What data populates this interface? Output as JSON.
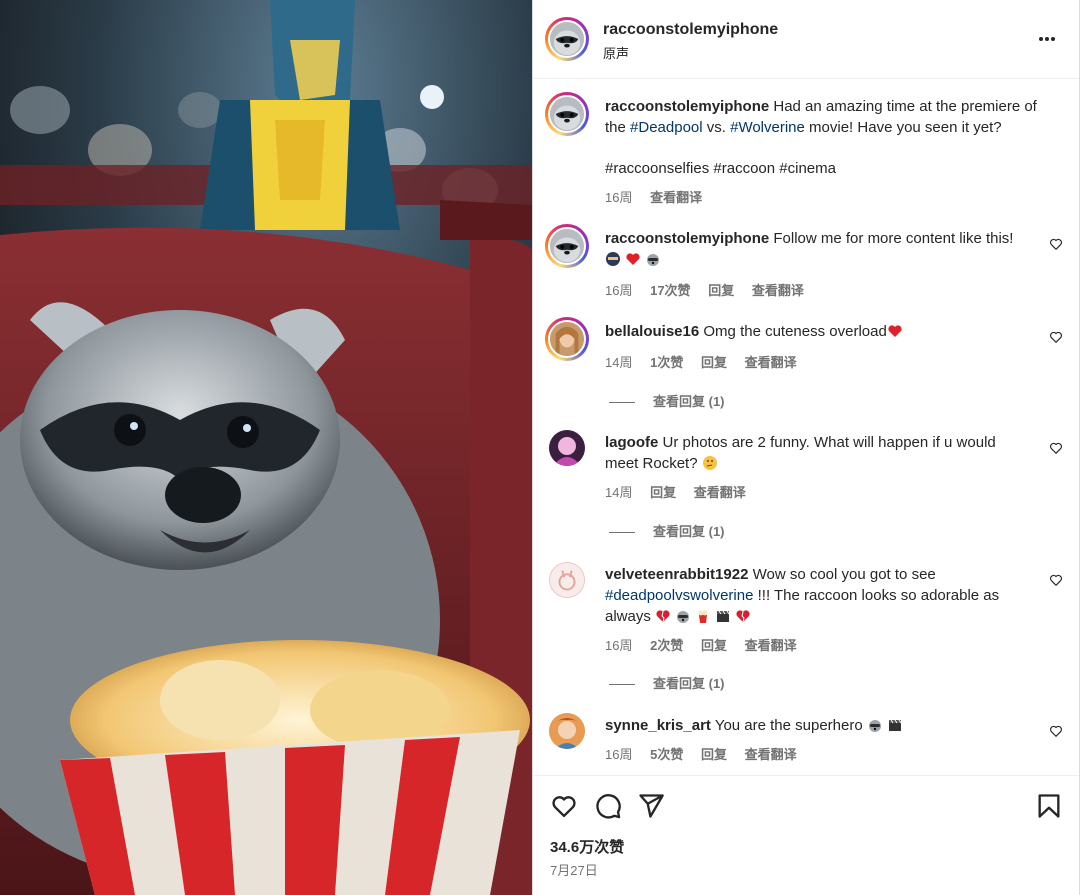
{
  "post": {
    "username": "raccoonstolemyiphone",
    "audio": "原声",
    "caption_text": "Had an amazing time at the premiere of the",
    "caption_tag1": "#Deadpool",
    "caption_mid": "vs.",
    "caption_tag2": "#Wolverine",
    "caption_end": "movie! Have you seen it yet?",
    "caption_hashtags": "#raccoonselfies #raccoon #cinema",
    "caption_time": "16周",
    "caption_translate": "查看翻译"
  },
  "comments": [
    {
      "user": "raccoonstolemyiphone",
      "text": "Follow me for more content like this!",
      "time": "16周",
      "likes": "17次赞",
      "reply": "回复",
      "translate": "查看翻译"
    },
    {
      "user": "bellalouise16",
      "text": "Omg the cuteness overload",
      "time": "14周",
      "likes": "1次赞",
      "reply": "回复",
      "translate": "查看翻译",
      "view_replies": "查看回复 (1)"
    },
    {
      "user": "lagoofe",
      "text": "Ur photos are 2 funny. What will happen if u would meet Rocket?",
      "time": "14周",
      "reply": "回复",
      "translate": "查看翻译",
      "view_replies": "查看回复 (1)"
    },
    {
      "user": "velveteenrabbit1922",
      "text_a": "Wow so cool you got to see",
      "tag": "#deadpoolvswolverine",
      "text_b": "!!! The raccoon looks so adorable as always",
      "time": "16周",
      "likes": "2次赞",
      "reply": "回复",
      "translate": "查看翻译",
      "view_replies": "查看回复 (1)"
    },
    {
      "user": "synne_kris_art",
      "text": "You are the superhero",
      "time": "16周",
      "likes": "5次赞",
      "reply": "回复",
      "translate": "查看翻译"
    }
  ],
  "footer": {
    "likes": "34.6万次赞",
    "date": "7月27日"
  },
  "icons": {
    "more": "more-options-icon",
    "like": "heart-icon",
    "comment": "comment-icon",
    "share": "send-icon",
    "save": "bookmark-icon"
  },
  "colors": {
    "link": "#00376b",
    "muted": "#737373",
    "text": "#262626"
  }
}
